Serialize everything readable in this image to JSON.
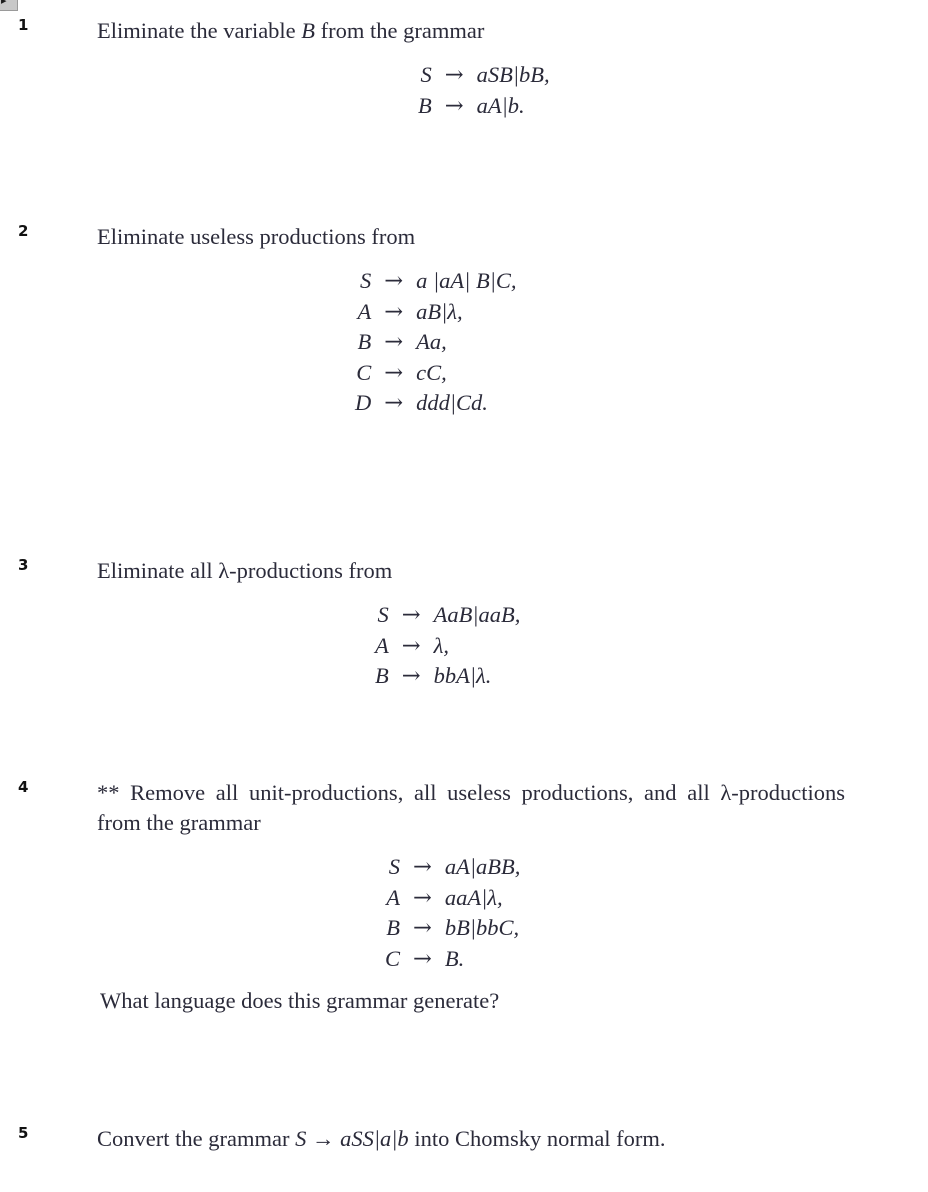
{
  "corner_widget": {
    "glyph": "▸"
  },
  "document": {
    "problems": [
      {
        "number": "1",
        "prompt_parts": {
          "pre": "Eliminate the variable ",
          "var": "B",
          "post": " from the grammar"
        },
        "grammar": [
          {
            "lhs": "S",
            "arrow": "→",
            "rhs_html": "aSB|bB,"
          },
          {
            "lhs": "B",
            "arrow": "→",
            "rhs_html": "aA|b."
          }
        ],
        "grammar_indent": 418,
        "tail": ""
      },
      {
        "number": "2",
        "prompt": "Eliminate useless productions from",
        "grammar": [
          {
            "lhs": "S",
            "arrow": "→",
            "rhs_html": "a |aA| B|C,"
          },
          {
            "lhs": "A",
            "arrow": "→",
            "rhs_html": "aB|λ,"
          },
          {
            "lhs": "B",
            "arrow": "→",
            "rhs_html": "Aa,"
          },
          {
            "lhs": "C",
            "arrow": "→",
            "rhs_html": "cC,"
          },
          {
            "lhs": "D",
            "arrow": "→",
            "rhs_html": "ddd|Cd."
          }
        ],
        "grammar_indent": 355,
        "tail": ""
      },
      {
        "number": "3",
        "prompt": "Eliminate all λ-productions from",
        "grammar": [
          {
            "lhs": "S",
            "arrow": "→",
            "rhs_html": "AaB|aaB,"
          },
          {
            "lhs": "A",
            "arrow": "→",
            "rhs_html": "λ,"
          },
          {
            "lhs": "B",
            "arrow": "→",
            "rhs_html": "bbA|λ."
          }
        ],
        "grammar_indent": 375,
        "tail": ""
      },
      {
        "number": "4",
        "prompt": "** Remove all unit-productions, all useless productions, and all λ-productions from the grammar",
        "grammar": [
          {
            "lhs": "S",
            "arrow": "→",
            "rhs_html": "aA|aBB,"
          },
          {
            "lhs": "A",
            "arrow": "→",
            "rhs_html": "aaA|λ,"
          },
          {
            "lhs": "B",
            "arrow": "→",
            "rhs_html": "bB|bbC,"
          },
          {
            "lhs": "C",
            "arrow": "→",
            "rhs_html": "B."
          }
        ],
        "grammar_indent": 385,
        "tail": "What language does this grammar generate?"
      },
      {
        "number": "5",
        "prompt_parts": {
          "pre": "Convert the grammar ",
          "math": "S → aSS|a|b",
          "post": " into Chomsky normal form."
        },
        "grammar": [],
        "tail": ""
      }
    ]
  },
  "style": {
    "text_color": "#2b2b3a",
    "number_color": "#111111",
    "background": "#ffffff"
  }
}
